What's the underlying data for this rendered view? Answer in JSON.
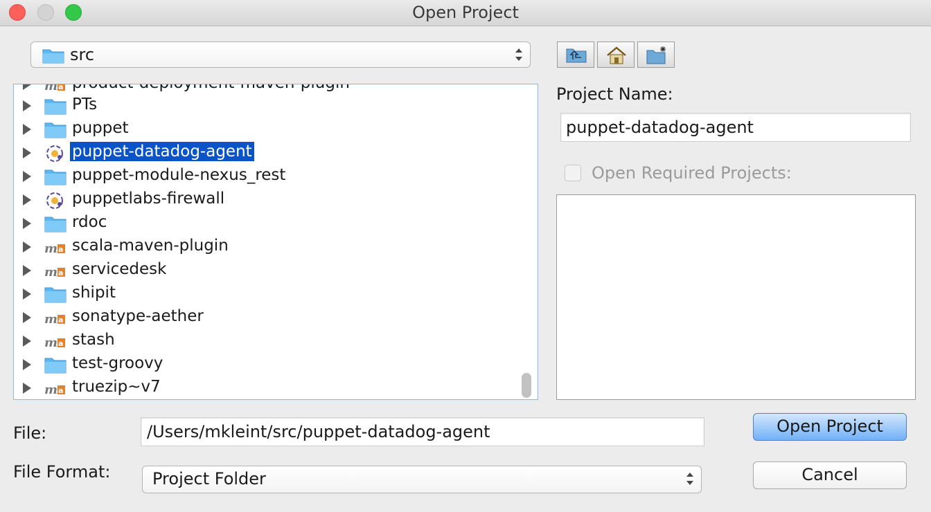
{
  "window": {
    "title": "Open Project"
  },
  "location": {
    "current": "src"
  },
  "tree": {
    "partial_top": "product-deployment-maven-plugin",
    "items": [
      {
        "label": "PTs",
        "icon": "folder-icon"
      },
      {
        "label": "puppet",
        "icon": "folder-icon"
      },
      {
        "label": "puppet-datadog-agent",
        "icon": "puppet-project-icon",
        "selected": true
      },
      {
        "label": "puppet-module-nexus_rest",
        "icon": "folder-icon"
      },
      {
        "label": "puppetlabs-firewall",
        "icon": "puppet-project-icon"
      },
      {
        "label": "rdoc",
        "icon": "folder-icon"
      },
      {
        "label": "scala-maven-plugin",
        "icon": "maven-project-icon"
      },
      {
        "label": "servicedesk",
        "icon": "maven-project-icon"
      },
      {
        "label": "shipit",
        "icon": "folder-icon"
      },
      {
        "label": "sonatype-aether",
        "icon": "maven-project-icon"
      },
      {
        "label": "stash",
        "icon": "maven-project-icon"
      },
      {
        "label": "test-groovy",
        "icon": "folder-icon"
      },
      {
        "label": "truezip~v7",
        "icon": "maven-project-icon"
      }
    ]
  },
  "project": {
    "name_label": "Project Name:",
    "name_value": "puppet-datadog-agent",
    "required_label": "Open Required Projects:"
  },
  "file": {
    "label": "File:",
    "value": "/Users/mkleint/src/puppet-datadog-agent"
  },
  "format": {
    "label": "File Format:",
    "value": "Project Folder"
  },
  "buttons": {
    "open": "Open Project",
    "cancel": "Cancel"
  },
  "colors": {
    "selection": "#0a54c7",
    "folder": "#5fb7ef",
    "primary_button": "#72b0f6"
  }
}
